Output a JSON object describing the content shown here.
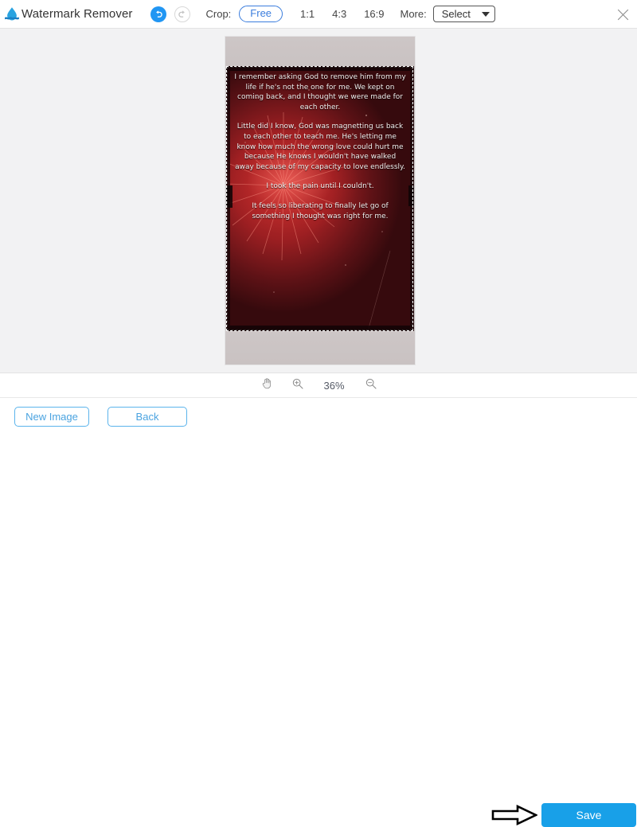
{
  "app": {
    "title": "Watermark Remover",
    "logo_icon": "water-drop-icon"
  },
  "toolbar": {
    "undo_icon": "undo-arrow-icon",
    "redo_icon": "redo-arrow-icon",
    "crop_label": "Crop:",
    "ratios": [
      {
        "label": "Free",
        "selected": true
      },
      {
        "label": "1:1",
        "selected": false
      },
      {
        "label": "4:3",
        "selected": false
      },
      {
        "label": "16:9",
        "selected": false
      }
    ],
    "more_label": "More:",
    "more_select_value": "Select",
    "caret_icon": "chevron-down-icon",
    "close_icon": "close-icon"
  },
  "canvas": {
    "pan_tool_icon": "hand-pan-icon",
    "zoom_in_icon": "zoom-in-icon",
    "zoom_out_icon": "zoom-out-icon",
    "zoom_level": "36%",
    "image": {
      "alt": "red fireworks poster photo with white text",
      "poster_paragraphs": [
        "I remember asking God to remove him from my life if he's not the one for me. We kept on coming back, and I thought we were made for each other.",
        "Little did I know, God was magnetting us back to each other to teach me. He's letting me know how much the wrong love could hurt me because He knows I wouldn't have walked away because of my capacity to love endlessly.",
        "I took the pain until I couldn't.",
        "It feels so liberating to finally let go of something I thought was right for me."
      ]
    }
  },
  "footer": {
    "new_image_label": "New Image",
    "back_label": "Back",
    "save_label": "Save",
    "pointer_arrow_icon": "right-arrow-annotation-icon"
  },
  "colors": {
    "accent_blue": "#18a0e8",
    "link_blue": "#4aa3e0",
    "ratio_blue": "#3b7ddd",
    "canvas_bg": "#f2f2f3",
    "toolbar_bg": "#ffffff"
  }
}
